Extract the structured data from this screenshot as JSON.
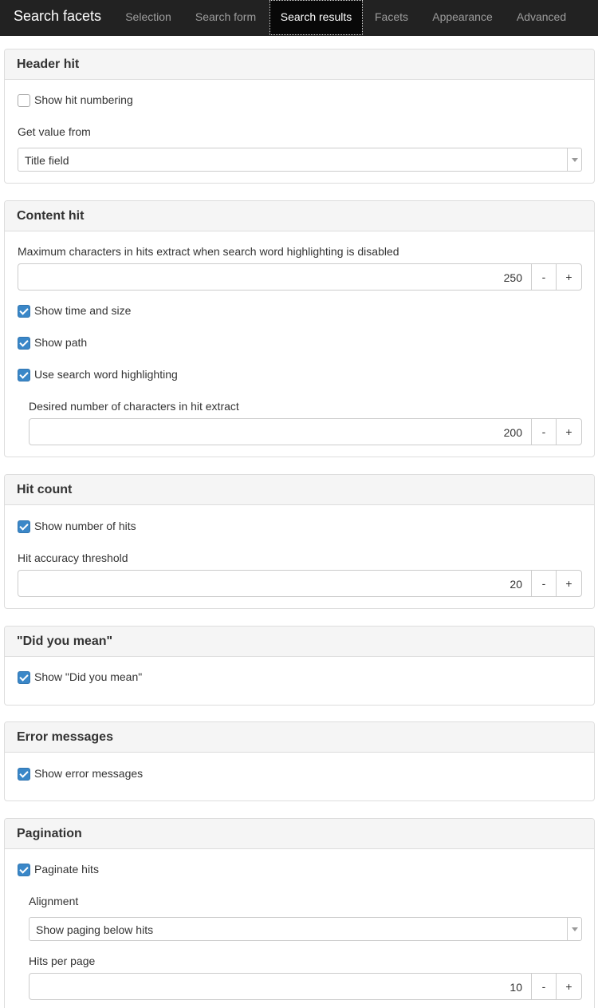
{
  "nav": {
    "brand": "Search facets",
    "tabs": [
      "Selection",
      "Search form",
      "Search results",
      "Facets",
      "Appearance",
      "Advanced"
    ],
    "active_tab": "Search results"
  },
  "header_hit": {
    "title": "Header hit",
    "show_numbering_label": "Show hit numbering",
    "show_numbering_checked": false,
    "get_value_label": "Get value from",
    "get_value_selected": "Title field"
  },
  "content_hit": {
    "title": "Content hit",
    "max_chars_label": "Maximum characters in hits extract when search word highlighting is disabled",
    "max_chars_value": "250",
    "show_time_size_label": "Show time and size",
    "show_path_label": "Show path",
    "use_highlighting_label": "Use search word highlighting",
    "desired_chars_label": "Desired number of characters in hit extract",
    "desired_chars_value": "200"
  },
  "hit_count": {
    "title": "Hit count",
    "show_number_label": "Show number of hits",
    "accuracy_label": "Hit accuracy threshold",
    "accuracy_value": "20"
  },
  "did_you_mean": {
    "title": "\"Did you mean\"",
    "show_label": "Show \"Did you mean\""
  },
  "error_messages": {
    "title": "Error messages",
    "show_label": "Show error messages"
  },
  "pagination": {
    "title": "Pagination",
    "paginate_label": "Paginate hits",
    "alignment_label": "Alignment",
    "alignment_selected": "Show paging below hits",
    "per_page_label": "Hits per page",
    "per_page_value": "10"
  },
  "spinner": {
    "minus": "-",
    "plus": "+"
  },
  "colors": {
    "navbar": "#222222",
    "checkbox": "#3a87c8",
    "panel_heading": "#f5f5f5"
  }
}
